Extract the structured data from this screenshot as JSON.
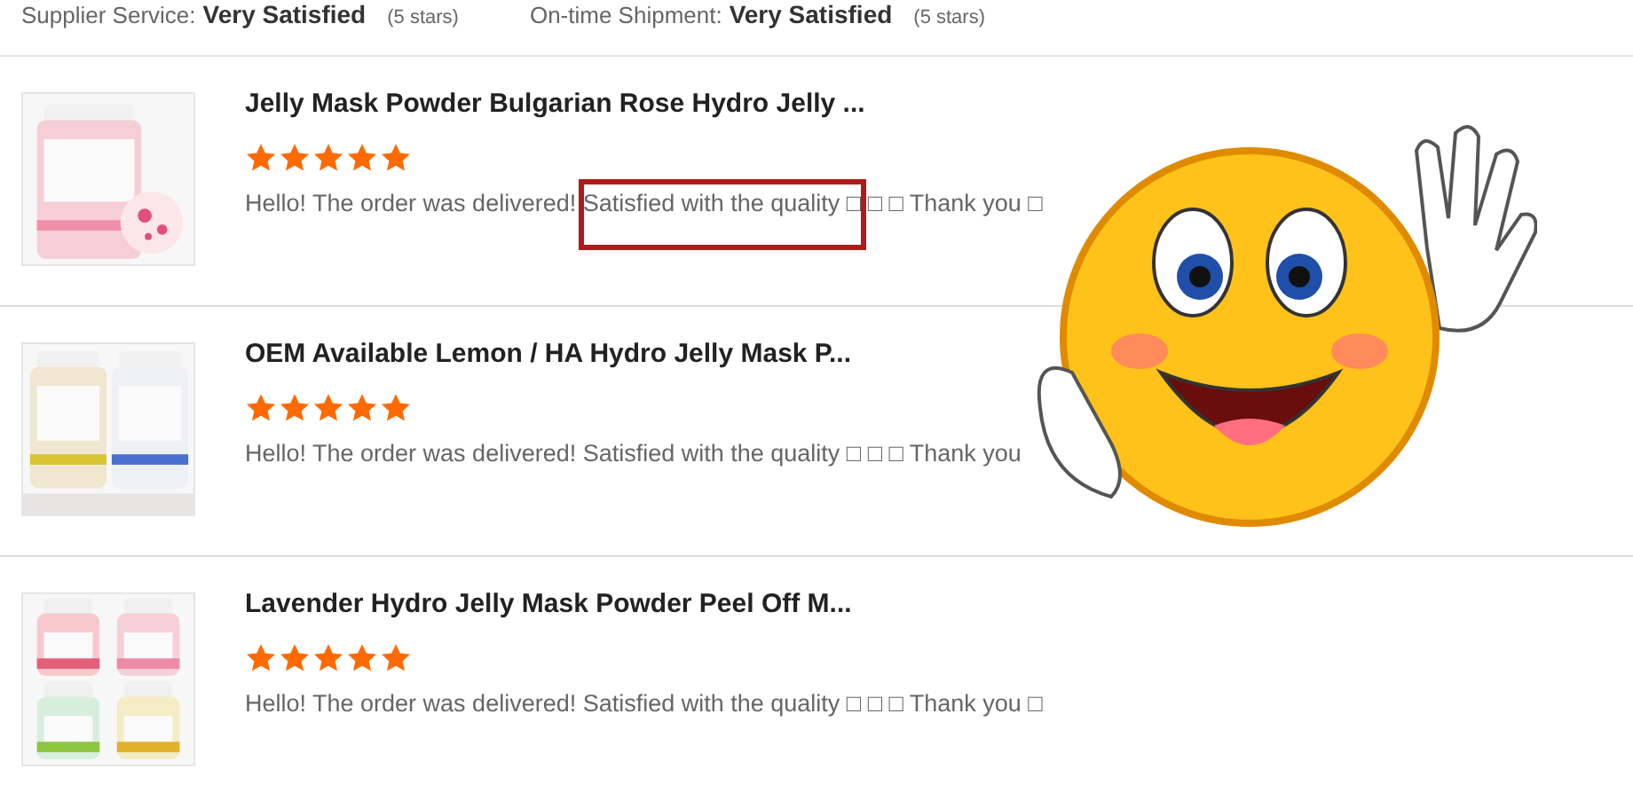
{
  "ratings": [
    {
      "label": "Supplier Service:",
      "value": "Very Satisfied",
      "count": "(5 stars)"
    },
    {
      "label": "On-time Shipment:",
      "value": "Very Satisfied",
      "count": "(5 stars)"
    }
  ],
  "reviews": [
    {
      "title": "Jelly Mask Powder Bulgarian Rose Hydro Jelly ...",
      "stars": 5,
      "text": "Hello! The order was delivered! Satisfied with the quality □ □ □ Thank you □",
      "highlighted": true
    },
    {
      "title": "OEM Available Lemon / HA Hydro Jelly Mask P...",
      "stars": 5,
      "text": "Hello! The order was delivered! Satisfied with the quality □ □ □ Thank you",
      "highlighted": false
    },
    {
      "title": "Lavender Hydro Jelly Mask Powder Peel Off M...",
      "stars": 5,
      "text": "Hello! The order was delivered! Satisfied with the quality □ □ □ Thank you □",
      "highlighted": false
    }
  ]
}
